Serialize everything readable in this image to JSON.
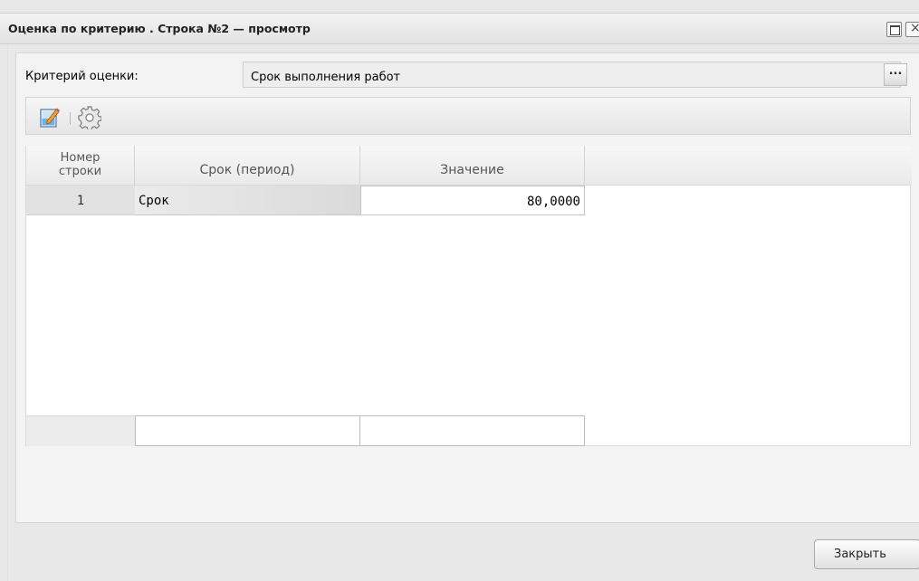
{
  "window": {
    "title": "Оценка по критерию . Строка №2 — просмотр",
    "buttons": [
      "maximize-icon",
      "close-icon"
    ]
  },
  "criterion": {
    "label": "Критерий оценки:",
    "value": "Срок выполнения работ",
    "picker_label": "..."
  },
  "toolbar": {
    "items": [
      "edit-icon",
      "settings-gear-icon"
    ]
  },
  "grid": {
    "columns": [
      "Номер строки",
      "Срок (период)",
      "Значение"
    ],
    "column_number_line1": "Номер",
    "column_number_line2": "строки",
    "rows": [
      {
        "number": "1",
        "period": "Срок",
        "value": "80,0000"
      }
    ]
  },
  "footer": {
    "close_label": "Закрыть"
  },
  "colors": {
    "background": "#e8e8e8",
    "panel": "#f3f3f3",
    "grid_background": "#ffffff",
    "header_gradient_top": "#f7f7f7",
    "header_gradient_bottom": "#eaeaea",
    "edit_icon_accent": "#4a9be0",
    "pencil_accent": "#f0a030"
  }
}
